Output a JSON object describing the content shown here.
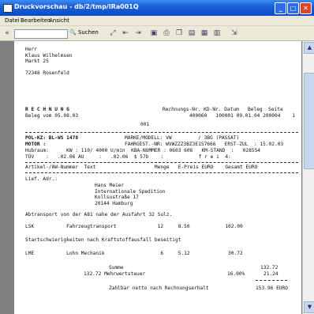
{
  "window": {
    "title": "Druckvorschau - db/2/tmp/lRa001Q"
  },
  "menu": [
    "Datei",
    "Bearbeiten",
    "Ansicht"
  ],
  "toolbar": {
    "nav_back": "«",
    "search_label": "Suchen"
  },
  "doc": {
    "addr": [
      "Herr",
      "Klaus Wilhelmsen",
      "Markt 25",
      "",
      "72348 Rosenfeld"
    ],
    "heading": "R E C H N U N G",
    "beleg": "Beleg vom 05.08.03",
    "rechnung_hdr": "Rechnungs-Nr. KD-Nr. Datum   Beleg  Seite",
    "rechnung_vals": "400060   100001 09.01.04 200004    1",
    "page_no": "001",
    "v1a": "POL-KZ: BL-WS 1478",
    "v1b": "MARKE/MODELL: VW         / 3BG (PASSAT)",
    "v2a": "MOTOR :",
    "v2b": "FAHRGEST.-NR: WVWZZZ3BZ3E157666   ERST-ZUL  : 15.02.03",
    "v3a": "Hubraum:      KW : 110/ 4000 U/min  KBA-NUMMER : 0603 606   KM-STAND  :   028554",
    "v4a": "TÜV    :   .02.06 AU     :   .02.06  $ 57b    :            f r e i  4:",
    "col_hdr": "Artikel-/AW-Nummer  Text                    Menge   E-Preis EURO    Gesamt EURO",
    "lief": "Lief. Adr.:",
    "lief_addr": [
      "Hans Meier",
      "Internationale Spedition",
      "Kollsustraße 17",
      "20144 Hamburg"
    ],
    "t1": "Abtransport von der A81 nahe der Ausfahrt 32 Sulz.",
    "r1": "LSK           Fahrzeugtransport              12     8.50            102.00",
    "t2": "Startschwierigkeiten nach Kraftstoffausfall beseitigt",
    "r2": "LME           Lohn Mechanik                   6     5.12             30.72",
    "sum_label": "Summe",
    "sum_val": "132.72",
    "mwst": "132.72 Mehrwertsteuer",
    "mwst_pct": "16.00%",
    "mwst_val": "21.24",
    "netto": "Zahlbar netto nach Rechnungserhalt",
    "netto_val": "153.96 EURO"
  }
}
